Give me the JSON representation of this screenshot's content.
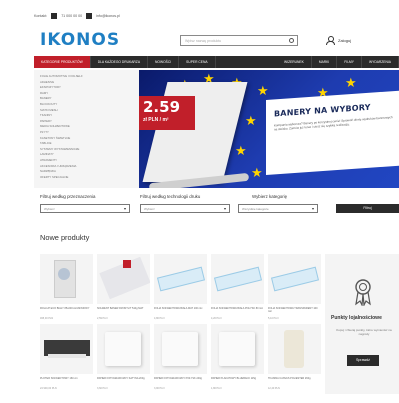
{
  "topbar": {
    "phone": "71 000 00 00",
    "email": "info@ikonos.pl",
    "lead": "Kontakt:"
  },
  "header": {
    "logo": "IKONOS",
    "search_placeholder": "Wpisz nazwę produktu",
    "login": "Zaloguj"
  },
  "nav": {
    "items": [
      {
        "label": "KATEGORIE PRODUKTÓW"
      },
      {
        "label": "DLA KAŻDEGO DRUKARZA"
      },
      {
        "label": "NOWOŚCI"
      },
      {
        "label": "SUPER CENA"
      },
      {
        "label": "WIZERUNEK"
      },
      {
        "label": "MARKI"
      },
      {
        "label": "FILMY"
      },
      {
        "label": "WYDARZENIA"
      }
    ]
  },
  "sidebar": {
    "categories": [
      "FOLIE AUTOMOTIVE I FIOLSELF",
      "ADHESIVE",
      "EKSPOZYTORY",
      "RAMY",
      "BANERY",
      "BLOCKOUTY",
      "SIATKI MESH",
      "TKANINY",
      "PAPIERY",
      "MEDIA SOLWENTOWE",
      "PŁYTY",
      "KASETONY ŚWIETLNE",
      "TABLICE",
      "SYSTEMY WYSTAWIENNICZE",
      "LAMINATY",
      "ATRAMENTY",
      "AKCESORIA I URZĄDZENIA",
      "NARZĘDZIA",
      "OFERTY SPECJALNE"
    ]
  },
  "banner": {
    "price": "2.59",
    "price_unit": "zł PLN / m²",
    "title": "BANERY NA WYBORY",
    "text": "Kampania wyborcza? Banery po korzystnej cenie! Sprawdź ofertę wydruków banerowych na stoisko. Zamów już teraz i ciesz się szybką realizacją."
  },
  "filters": {
    "by_use_label": "Filtruj według przeznaczenia",
    "by_use_value": "Wybierz",
    "by_tech_label": "Filtruj według technologii druku",
    "by_tech_value": "Wybierz",
    "category_label": "Wybierz kategorię",
    "category_value": "Wszystkie kategorie",
    "submit": "Filtruj"
  },
  "new_products": {
    "title": "Nowe produkty",
    "items": [
      {
        "name": "ROLLUP ECO BIAŁY 85x200 ALUMINIOWY",
        "price": "495,00 PLN",
        "art": "rollup"
      },
      {
        "name": "SOLWENT BANER FRONTLIT 510g MAT",
        "price": "2,59 PLN",
        "art": "banner"
      },
      {
        "name": "FOLIA SOLWENTOWA BIAŁA MAT 100 mic",
        "price": "4,80 PLN",
        "art": "film"
      },
      {
        "name": "FOLIA SOLWENTOWA BIAŁA POŁYSK 80 mic",
        "price": "4,20 PLN",
        "art": "film"
      },
      {
        "name": "FOLIA SOLWENTOWA TRANSPARENT 100 mic",
        "price": "5,10 PLN",
        "art": "film"
      },
      {
        "name": "PLOTER SOLWENTOWY 160 cm",
        "price": "24 900,00 PLN",
        "art": "printer"
      },
      {
        "name": "PAPIER FOTOGRAFICZNY SATYNA 200g",
        "price": "3,60 PLN",
        "art": "paper"
      },
      {
        "name": "PAPIER FOTOGRAFICZNY POŁYSK 240g",
        "price": "3,90 PLN",
        "art": "paper"
      },
      {
        "name": "PAPIER PLAKATOWY BLUEBACK 115g",
        "price": "1,80 PLN",
        "art": "paper"
      },
      {
        "name": "TKANINA CANVAS POLIESTER 260g",
        "price": "12,40 PLN",
        "art": "canvas"
      }
    ]
  },
  "loyalty": {
    "title": "Punkty lojalnościowe",
    "text": "Kupuj i zbieraj punkty, które wymienisz na nagrody",
    "button": "Sprawdź"
  },
  "colors": {
    "accent": "#c11f2a",
    "logo": "#1f7fc3",
    "dark": "#2b2b2b"
  }
}
